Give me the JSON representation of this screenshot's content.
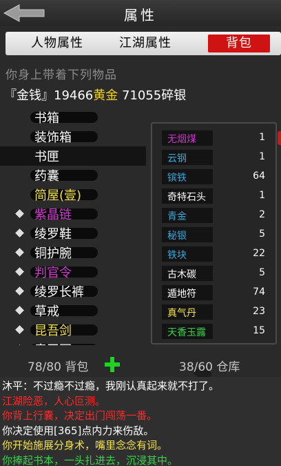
{
  "header": {
    "title": "属性"
  },
  "tabs": [
    {
      "label": "人物属性",
      "active": false
    },
    {
      "label": "江湖属性",
      "active": false
    },
    {
      "label": "背包",
      "active": true
    }
  ],
  "subtitle": "你身上带着下列物品",
  "money": {
    "prefix": "『金钱』19466",
    "gold_label": "黄金",
    "silver_text": " 71055碎银"
  },
  "left_items": [
    {
      "label": "书箱",
      "color": "#ffffff",
      "marked": false,
      "selected": false
    },
    {
      "label": "装饰箱",
      "color": "#ffffff",
      "marked": false,
      "selected": false
    },
    {
      "label": "书匣",
      "color": "#ffffff",
      "marked": false,
      "selected": true
    },
    {
      "label": "药囊",
      "color": "#ffffff",
      "marked": false,
      "selected": false
    },
    {
      "label": "简屋(壹)",
      "color": "#f2e24a",
      "marked": false,
      "selected": false
    },
    {
      "label": "紫晶链",
      "color": "#d23ad2",
      "marked": true,
      "selected": false
    },
    {
      "label": "绫罗鞋",
      "color": "#ffffff",
      "marked": true,
      "selected": false
    },
    {
      "label": "铜护腕",
      "color": "#ffffff",
      "marked": true,
      "selected": false
    },
    {
      "label": "判官令",
      "color": "#d23ad2",
      "marked": true,
      "selected": false
    },
    {
      "label": "绫罗长裤",
      "color": "#ffffff",
      "marked": true,
      "selected": false
    },
    {
      "label": "草戒",
      "color": "#ffffff",
      "marked": true,
      "selected": false
    },
    {
      "label": "昆吾剑",
      "color": "#f2e24a",
      "marked": true,
      "selected": false
    },
    {
      "label": "青玉冠",
      "color": "#ffffff",
      "marked": true,
      "selected": false
    }
  ],
  "inventory": [
    {
      "name": "无烟煤",
      "qty": "1",
      "color": "#c236c2"
    },
    {
      "name": "云钢",
      "qty": "1",
      "color": "#3aa6d8"
    },
    {
      "name": "镔铁",
      "qty": "64",
      "color": "#3aa6d8"
    },
    {
      "name": "奇特石头",
      "qty": "1",
      "color": "#ffffff"
    },
    {
      "name": "青金",
      "qty": "2",
      "color": "#3aa6d8"
    },
    {
      "name": "秘银",
      "qty": "5",
      "color": "#3aa6d8"
    },
    {
      "name": "铁块",
      "qty": "22",
      "color": "#3aa6d8"
    },
    {
      "name": "古木碳",
      "qty": "5",
      "color": "#ffffff"
    },
    {
      "name": "遁地符",
      "qty": "74",
      "color": "#ffffff"
    },
    {
      "name": "真气丹",
      "qty": "23",
      "color": "#f2e24a"
    },
    {
      "name": "天香玉露",
      "qty": "15",
      "color": "#3ad24a"
    }
  ],
  "bag": {
    "bag_text": "78/80 背包",
    "storage_text": "38/60 仓库"
  },
  "log": [
    {
      "text": "沐平：不过瘾不过瘾，我刚认真起来就不打了。",
      "color": "#ffffff"
    },
    {
      "text": "江湖险恶，人心叵测。",
      "color": "#ff2a2a"
    },
    {
      "text": "你背上行囊，决定出门闯荡一番。",
      "color": "#ff2a2a"
    },
    {
      "text": "你决定使用[365]点内力来伤敌。",
      "color": "#ffffff"
    },
    {
      "text": "你开始施展分身术，嘴里念念有词。",
      "color": "#f2e24a"
    },
    {
      "text": "你捧起书本，一头扎进去，沉浸其中。",
      "color": "#3ad24a"
    }
  ],
  "icons": {
    "back": "back-arrow-icon",
    "plus": "plus-icon"
  }
}
